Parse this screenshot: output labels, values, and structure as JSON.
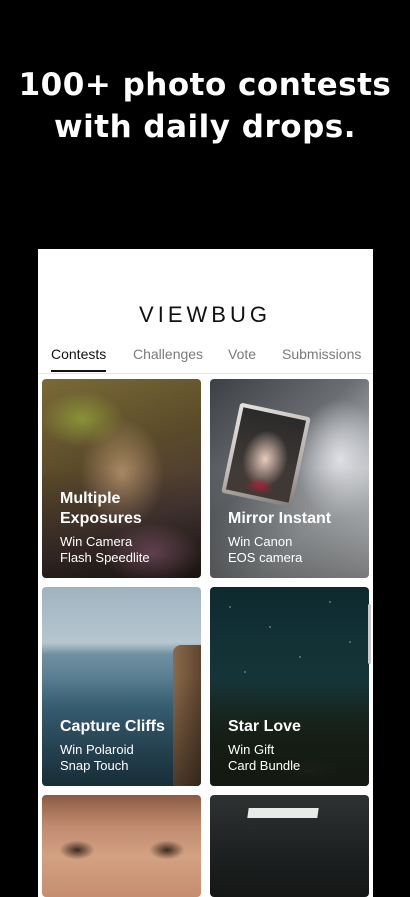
{
  "headline": {
    "line1": "100+ photo contests",
    "line2": "with daily drops."
  },
  "app": {
    "logo": "VIEWBUG"
  },
  "tabs": [
    {
      "label": "Contests",
      "active": true
    },
    {
      "label": "Challenges",
      "active": false
    },
    {
      "label": "Vote",
      "active": false
    },
    {
      "label": "Submissions",
      "active": false
    }
  ],
  "contests": [
    {
      "title_line1": "Multiple",
      "title_line2": "Exposures",
      "prize_line1": "Win Camera",
      "prize_line2": "Flash Speedlite"
    },
    {
      "title_line1": "Mirror Instant",
      "title_line2": "",
      "prize_line1": "Win Canon",
      "prize_line2": "EOS camera"
    },
    {
      "title_line1": "Capture Cliffs",
      "title_line2": "",
      "prize_line1": "Win Polaroid",
      "prize_line2": "Snap Touch"
    },
    {
      "title_line1": "Star Love",
      "title_line2": "",
      "prize_line1": "Win Gift",
      "prize_line2": "Card Bundle"
    }
  ],
  "colors": {
    "background": "#000000",
    "panel": "#ffffff",
    "active_tab": "#111111",
    "inactive_tab": "#7a7a7a"
  }
}
